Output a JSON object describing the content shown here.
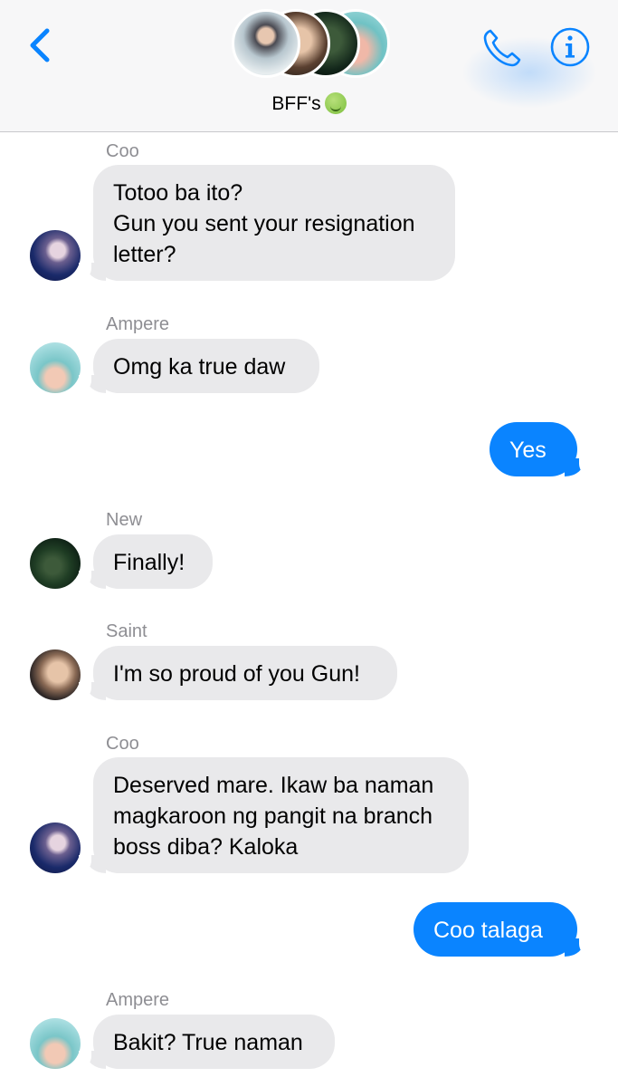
{
  "header": {
    "title": "BFF's",
    "emoji": "nauseated-face",
    "back_icon": "chevron-left-icon",
    "call_icon": "phone-icon",
    "info_icon": "info-icon",
    "accent_color": "#0a84ff"
  },
  "messages": [
    {
      "sender": "Coo",
      "text": "Totoo ba ito?\nGun you sent your resignation letter?",
      "direction": "incoming"
    },
    {
      "sender": "Ampere",
      "text": "Omg ka true daw",
      "direction": "incoming"
    },
    {
      "text": "Yes",
      "direction": "outgoing"
    },
    {
      "sender": "New",
      "text": "Finally!",
      "direction": "incoming"
    },
    {
      "sender": "Saint",
      "text": "I'm so proud of you Gun!",
      "direction": "incoming"
    },
    {
      "sender": "Coo",
      "text": "Deserved mare. Ikaw ba naman magkaroon ng pangit na branch boss diba? Kaloka",
      "direction": "incoming"
    },
    {
      "text": "Coo talaga",
      "direction": "outgoing"
    },
    {
      "sender": "Ampere",
      "text": "Bakit? True naman",
      "direction": "incoming"
    }
  ],
  "colors": {
    "incoming_bubble": "#e9e9eb",
    "outgoing_bubble": "#0a84ff",
    "sender_label": "#8e8e93"
  }
}
